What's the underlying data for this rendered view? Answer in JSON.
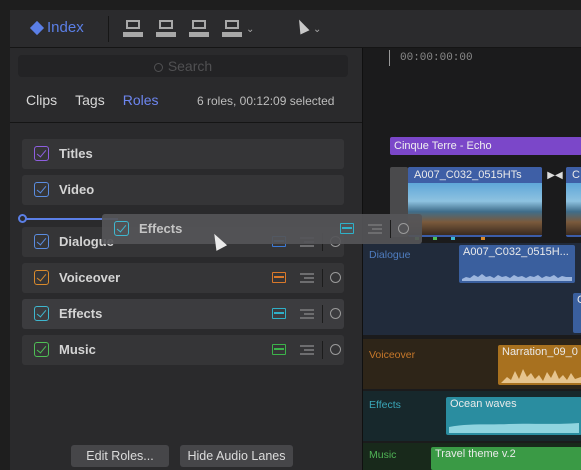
{
  "toolbar": {
    "index_label": "Index",
    "tools": [
      "append-clip-icon",
      "insert-clip-icon",
      "overwrite-clip-icon",
      "connect-clip-icon",
      "select-tool-icon"
    ]
  },
  "index_panel": {
    "search_placeholder": "Search",
    "tabs": [
      {
        "label": "Clips",
        "active": false
      },
      {
        "label": "Tags",
        "active": false
      },
      {
        "label": "Roles",
        "active": true
      }
    ],
    "selection_info": "6 roles, 00:12:09 selected",
    "roles": [
      {
        "label": "Titles",
        "color": "#8e5fe0",
        "has_lanes": false
      },
      {
        "label": "Video",
        "color": "#5b8de0",
        "has_lanes": false
      },
      {
        "label": "Dialogue",
        "color": "#5b8de0",
        "has_lanes": true,
        "lane_color": "#3b7ad8"
      },
      {
        "label": "Voiceover",
        "color": "#d98a2c",
        "has_lanes": true,
        "lane_color": "#d9782a"
      },
      {
        "label": "Effects",
        "color": "#3fb7cf",
        "has_lanes": true,
        "lane_color": "#2fb0c8"
      },
      {
        "label": "Music",
        "color": "#4fbf55",
        "has_lanes": true,
        "lane_color": "#3cb34a"
      }
    ],
    "dragging_role": {
      "label": "Effects",
      "color": "#3fb7cf"
    },
    "buttons": {
      "edit_roles": "Edit Roles...",
      "hide_audio_lanes": "Hide Audio Lanes"
    }
  },
  "timeline": {
    "timecode": "00:00:00:00",
    "title_clip": "Cinque Terre - Echo",
    "video_clip_1": "A007_C032_0515HTs",
    "video_clip_2": "C",
    "dialogue_label": "Dialogue",
    "dialogue_clip": "A007_C032_0515H...",
    "dialogue_clip_2": "C",
    "voiceover_label": "Voiceover",
    "voiceover_clip": "Narration_09_0",
    "effects_label": "Effects",
    "effects_clip": "Ocean waves",
    "music_label": "Music",
    "music_clip": "Travel theme v.2"
  }
}
